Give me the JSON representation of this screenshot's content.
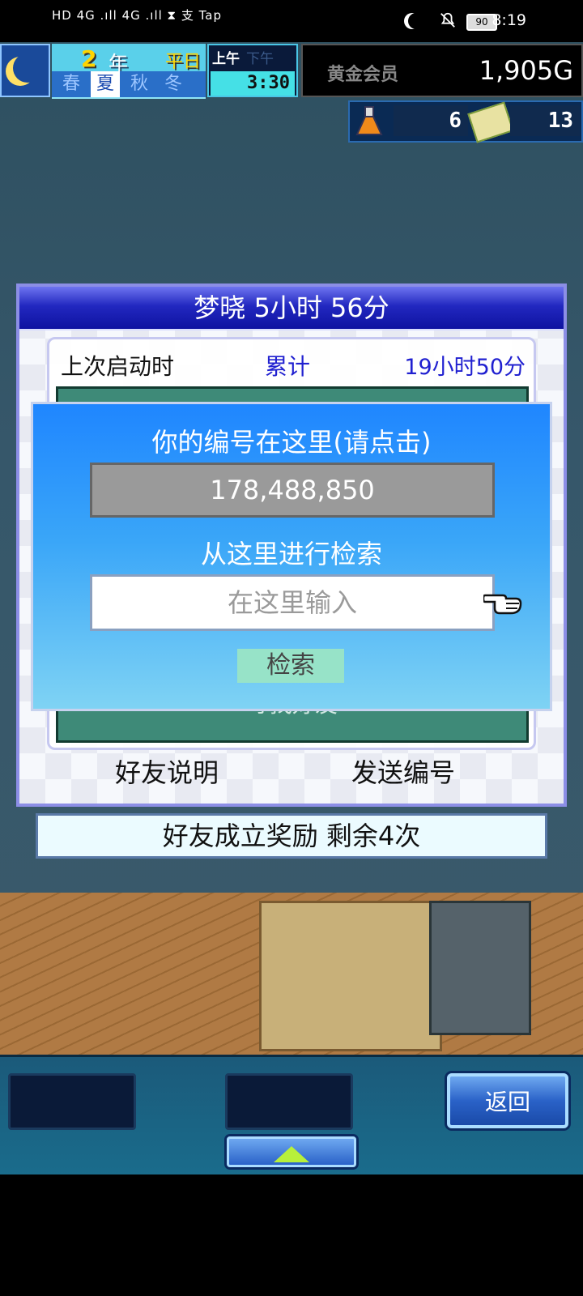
{
  "status_bar": {
    "left_text": "HD 4G .ıll 4G .ıll ⧗ 支 Tap",
    "battery": "90",
    "time": "8:19"
  },
  "hud": {
    "year": "2",
    "year_label": "年",
    "day_type": "平日",
    "seasons": [
      "春",
      "夏",
      "秋",
      "冬"
    ],
    "active_season": "夏",
    "am_label": "上午",
    "pm_label": "下午",
    "clock": "3:30",
    "membership_label": "黄金会员",
    "money": "1,905G",
    "research_points": "6",
    "tickets": "13"
  },
  "friend_panel": {
    "title": "梦晓  5小时 56分",
    "last_launch_label": "上次启动时",
    "total_label": "累计",
    "total_value": "19小时50分",
    "find_friend_label": "寻找好友",
    "help_button": "好友说明",
    "send_button": "发送编号"
  },
  "bonus_bar": "好友成立奖励  剩余4次",
  "search_dialog": {
    "your_id_label": "你的编号在这里(请点击)",
    "your_id": "178,488,850",
    "search_label": "从这里进行检索",
    "input_placeholder": "在这里输入",
    "search_button": "检索"
  },
  "toolbar": {
    "back_button": "返回"
  }
}
